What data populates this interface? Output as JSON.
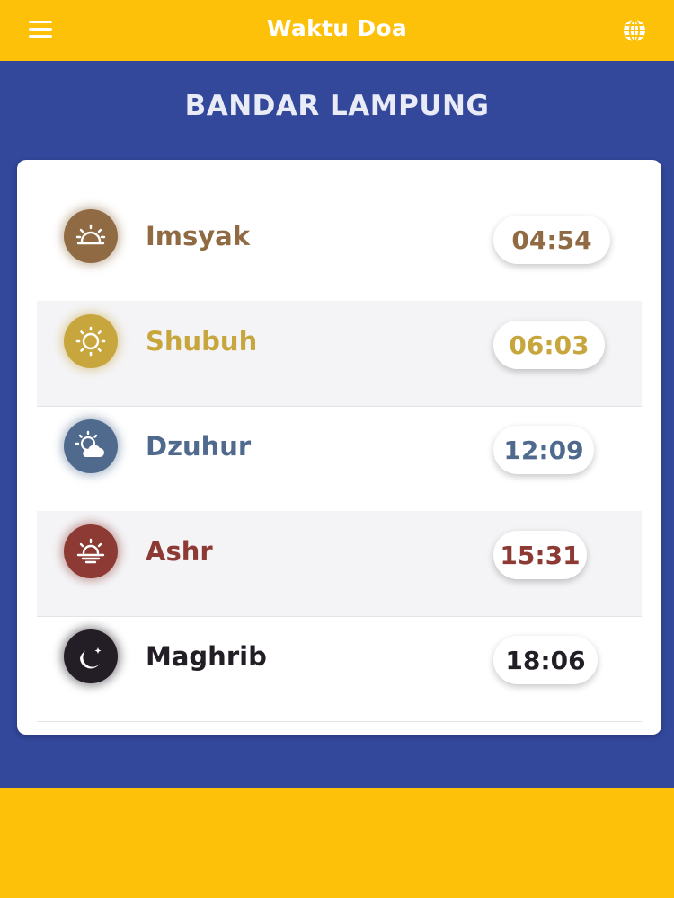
{
  "app": {
    "title": "Waktu Doa"
  },
  "header": {
    "menu_icon": "menu-icon",
    "globe_icon": "globe-icon"
  },
  "city": "BANDAR LAMPUNG",
  "colors": {
    "topbar": "#fdc10a",
    "main_bg": "#33479b",
    "imsyak": "#8f6a43",
    "shubuh": "#c7a63e",
    "dzuhur": "#506a8e",
    "ashr": "#8c3a33",
    "maghrib": "#231d25"
  },
  "prayers": [
    {
      "name": "Imsyak",
      "time": "04:54",
      "icon": "sunrise-icon"
    },
    {
      "name": "Shubuh",
      "time": "06:03",
      "icon": "sun-icon"
    },
    {
      "name": "Dzuhur",
      "time": "12:09",
      "icon": "sun-cloud-icon"
    },
    {
      "name": "Ashr",
      "time": "15:31",
      "icon": "sunset-icon"
    },
    {
      "name": "Maghrib",
      "time": "18:06",
      "icon": "moon-icon"
    }
  ]
}
